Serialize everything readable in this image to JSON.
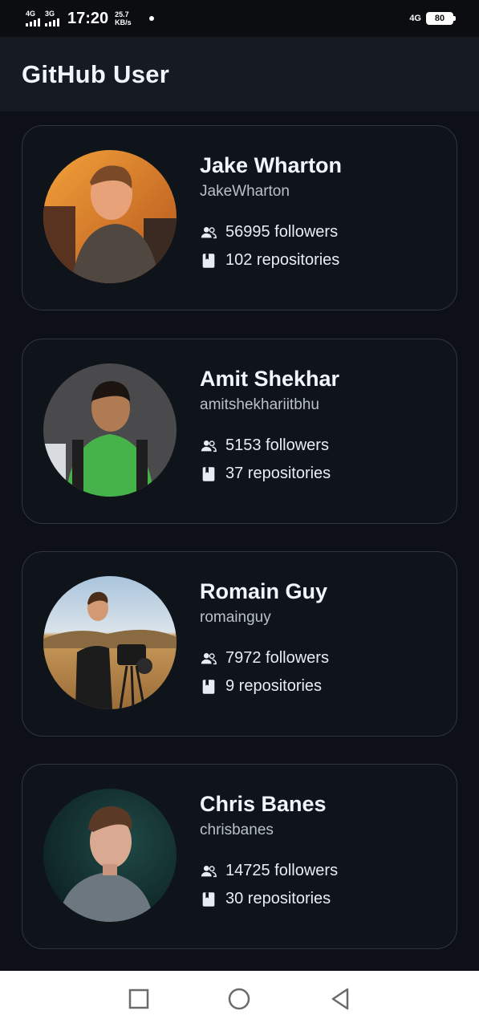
{
  "status_bar": {
    "sim1": "4G",
    "sim2": "3G",
    "time": "17:20",
    "speed_value": "25.7",
    "speed_unit": "KB/s",
    "network": "4G",
    "battery": "80"
  },
  "app_bar": {
    "title": "GitHub User"
  },
  "users": [
    {
      "name": "Jake Wharton",
      "login": "JakeWharton",
      "followers": "56995 followers",
      "repositories": "102 repositories"
    },
    {
      "name": "Amit Shekhar",
      "login": "amitshekhariitbhu",
      "followers": "5153 followers",
      "repositories": "37 repositories"
    },
    {
      "name": "Romain Guy",
      "login": "romainguy",
      "followers": "7972 followers",
      "repositories": "9 repositories"
    },
    {
      "name": "Chris Banes",
      "login": "chrisbanes",
      "followers": "14725 followers",
      "repositories": "30 repositories"
    }
  ],
  "icons": {
    "followers": "people-icon",
    "repositories": "book-icon",
    "nav_recent": "square-icon",
    "nav_home": "circle-icon",
    "nav_back": "triangle-back-icon"
  },
  "colors": {
    "background": "#0d1117",
    "app_bar": "#161b22",
    "card_border": "#30363d"
  }
}
